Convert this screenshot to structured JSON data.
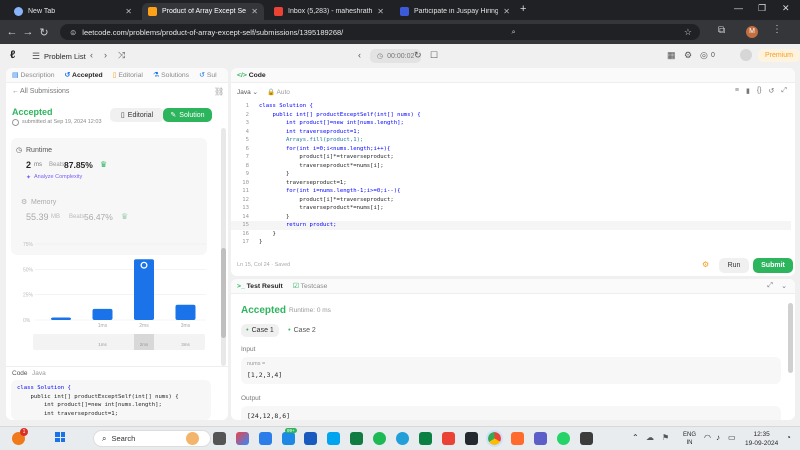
{
  "browser": {
    "tabs": [
      {
        "title": "New Tab",
        "active": false,
        "icon": "globe-icon",
        "color": "#8ab4f8"
      },
      {
        "title": "Product of Array Except Self - L",
        "active": true,
        "icon": "leetcode-icon",
        "color": "#ffa116"
      },
      {
        "title": "Inbox (5,283) - maheshrathinam",
        "active": false,
        "icon": "gmail-icon",
        "color": "#ea4335"
      },
      {
        "title": "Participate in Juspay Hiring Cha",
        "active": false,
        "icon": "unstop-icon",
        "color": "#3b5bdb"
      }
    ],
    "url": "leetcode.com/problems/product-of-array-except-self/submissions/1395189268/",
    "profile_initial": "M"
  },
  "header": {
    "problem_list": "Problem List",
    "timer": "00:00:02",
    "coins": "0",
    "premium": "Premium"
  },
  "left": {
    "tabs": [
      "Description",
      "Accepted",
      "Editorial",
      "Solutions",
      "Sul"
    ],
    "back_label": "All Submissions",
    "status": "Accepted",
    "submitted": "submitted at Sep 19, 2024 12:03",
    "editorial_btn": "Editorial",
    "solution_btn": "Solution",
    "runtime_label": "Runtime",
    "runtime_value": "2",
    "runtime_unit": "ms",
    "runtime_beats_label": "Beats",
    "runtime_beats": "87.85%",
    "analyze": "Analyze Complexity",
    "memory_label": "Memory",
    "memory_value": "55.39",
    "memory_unit": "MB",
    "memory_beats_label": "Beats",
    "memory_beats": "56.47%",
    "code_tab": "Code",
    "lang_tab": "Java",
    "code_preview": [
      "class Solution {",
      "    public int[] productExceptSelf(int[] nums) {",
      "        int product[]=new int[nums.length];",
      "        int traverseproduct=1;"
    ]
  },
  "chart_data": {
    "type": "bar",
    "ylabel": "",
    "ytick_labels": [
      "75%",
      "50%",
      "25%",
      "0%"
    ],
    "ylim": [
      0,
      75
    ],
    "categories": [
      "",
      "1ms",
      "2ms",
      "3ms"
    ],
    "values": [
      2.5,
      11,
      60,
      15
    ],
    "highlight": "2ms",
    "bar_color": "#1a73e8",
    "mini_labels": [
      "",
      "1ms",
      "2ms",
      "3ms"
    ]
  },
  "editor": {
    "title": "Code",
    "language": "Java",
    "mode": "Auto",
    "lines": [
      "class Solution {",
      "    public int[] productExceptSelf(int[] nums) {",
      "        int product[]=new int[nums.length];",
      "        int traverseproduct=1;",
      "        Arrays.fill(product,1);",
      "        for(int i=0;i<nums.length;i++){",
      "            product[i]*=traverseproduct;",
      "            traverseproduct*=nums[i];",
      "        }",
      "        traverseproduct=1;",
      "        for(int i=nums.length-1;i>=0;i--){",
      "            product[i]*=traverseproduct;",
      "            traverseproduct*=nums[i];",
      "        }",
      "        return product;",
      "    }",
      "}"
    ],
    "status": "Ln 15, Col 24  ·  Saved",
    "run": "Run",
    "submit": "Submit"
  },
  "test": {
    "tab_result": "Test Result",
    "tab_case": "Testcase",
    "status": "Accepted",
    "runtime": "Runtime: 0 ms",
    "case1": "Case 1",
    "case2": "Case 2",
    "input_label": "Input",
    "var": "nums =",
    "input_value": "[1,2,3,4]",
    "output_label": "Output",
    "output_value": "[24,12,8,6]"
  },
  "taskbar": {
    "search": "Search",
    "lang1": "ENG",
    "lang2": "IN",
    "time": "12:35",
    "date": "19-09-2024",
    "badge": "1",
    "widget_badge": "99+"
  }
}
